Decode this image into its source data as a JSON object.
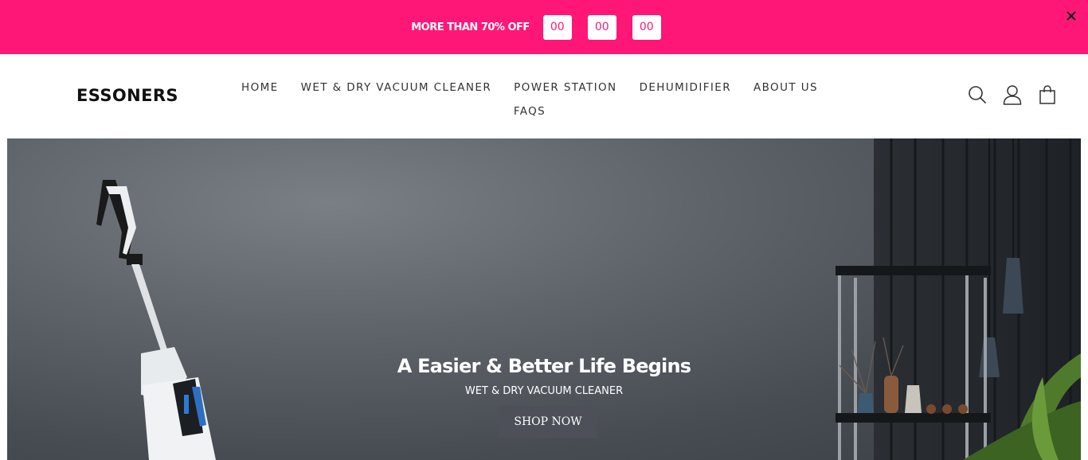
{
  "promo": {
    "text": "MORE THAN 70% OFF",
    "timer": [
      "00",
      "00",
      "00"
    ],
    "close_icon": "close-icon",
    "bg_color": "#ff1777"
  },
  "header": {
    "logo": "ESSONERS",
    "nav": [
      "HOME",
      "WET & DRY VACUUM CLEANER",
      "POWER STATION",
      "DEHUMIDIFIER",
      "ABOUT US",
      "FAQS"
    ],
    "icons": [
      "search-icon",
      "account-icon",
      "cart-icon"
    ]
  },
  "hero": {
    "title": "A Easier & Better Life Begins",
    "subtitle": "WET & DRY VACUUM CLEANER",
    "button": "SHOP NOW"
  }
}
